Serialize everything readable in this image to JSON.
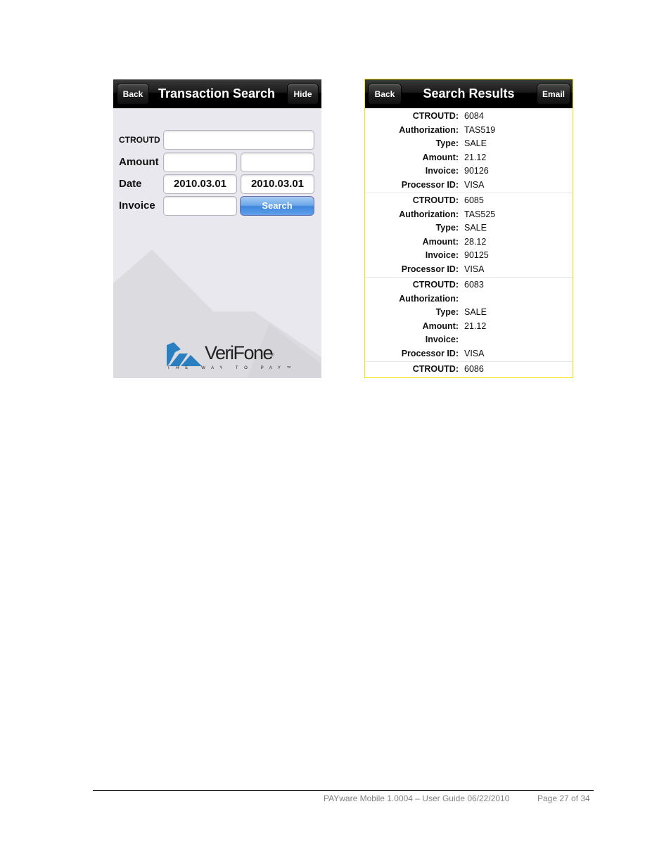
{
  "transaction_search": {
    "title": "Transaction Search",
    "back_label": "Back",
    "hide_label": "Hide",
    "fields": {
      "ctroutd_label": "CTROUTD",
      "ctroutd_value": "",
      "amount_label": "Amount",
      "amount_from_value": "",
      "amount_to_value": "",
      "date_label": "Date",
      "date_from_value": "2010.03.01",
      "date_to_value": "2010.03.01",
      "invoice_label": "Invoice",
      "invoice_value": ""
    },
    "search_label": "Search",
    "logo": {
      "brand": "VeriFone",
      "registered": "®",
      "tagline": "THE WAY TO PAY™",
      "brand_color": "#2a7fc1"
    }
  },
  "search_results": {
    "title": "Search Results",
    "back_label": "Back",
    "email_label": "Email",
    "field_labels": {
      "ctroutd": "CTROUTD:",
      "authorization": "Authorization:",
      "type": "Type:",
      "amount": "Amount:",
      "invoice": "Invoice:",
      "processor_id": "Processor ID:"
    },
    "results": [
      {
        "ctroutd": "6084",
        "authorization": "TAS519",
        "type": "SALE",
        "amount": "21.12",
        "invoice": "90126",
        "processor_id": "VISA"
      },
      {
        "ctroutd": "6085",
        "authorization": "TAS525",
        "type": "SALE",
        "amount": "28.12",
        "invoice": "90125",
        "processor_id": "VISA"
      },
      {
        "ctroutd": "6083",
        "authorization": "",
        "type": "SALE",
        "amount": "21.12",
        "invoice": "",
        "processor_id": "VISA"
      },
      {
        "ctroutd": "6086"
      }
    ]
  },
  "footer": {
    "doc_title": "PAYware Mobile 1.0004 – User Guide 06/22/2010",
    "page": "Page 27 of 34"
  }
}
